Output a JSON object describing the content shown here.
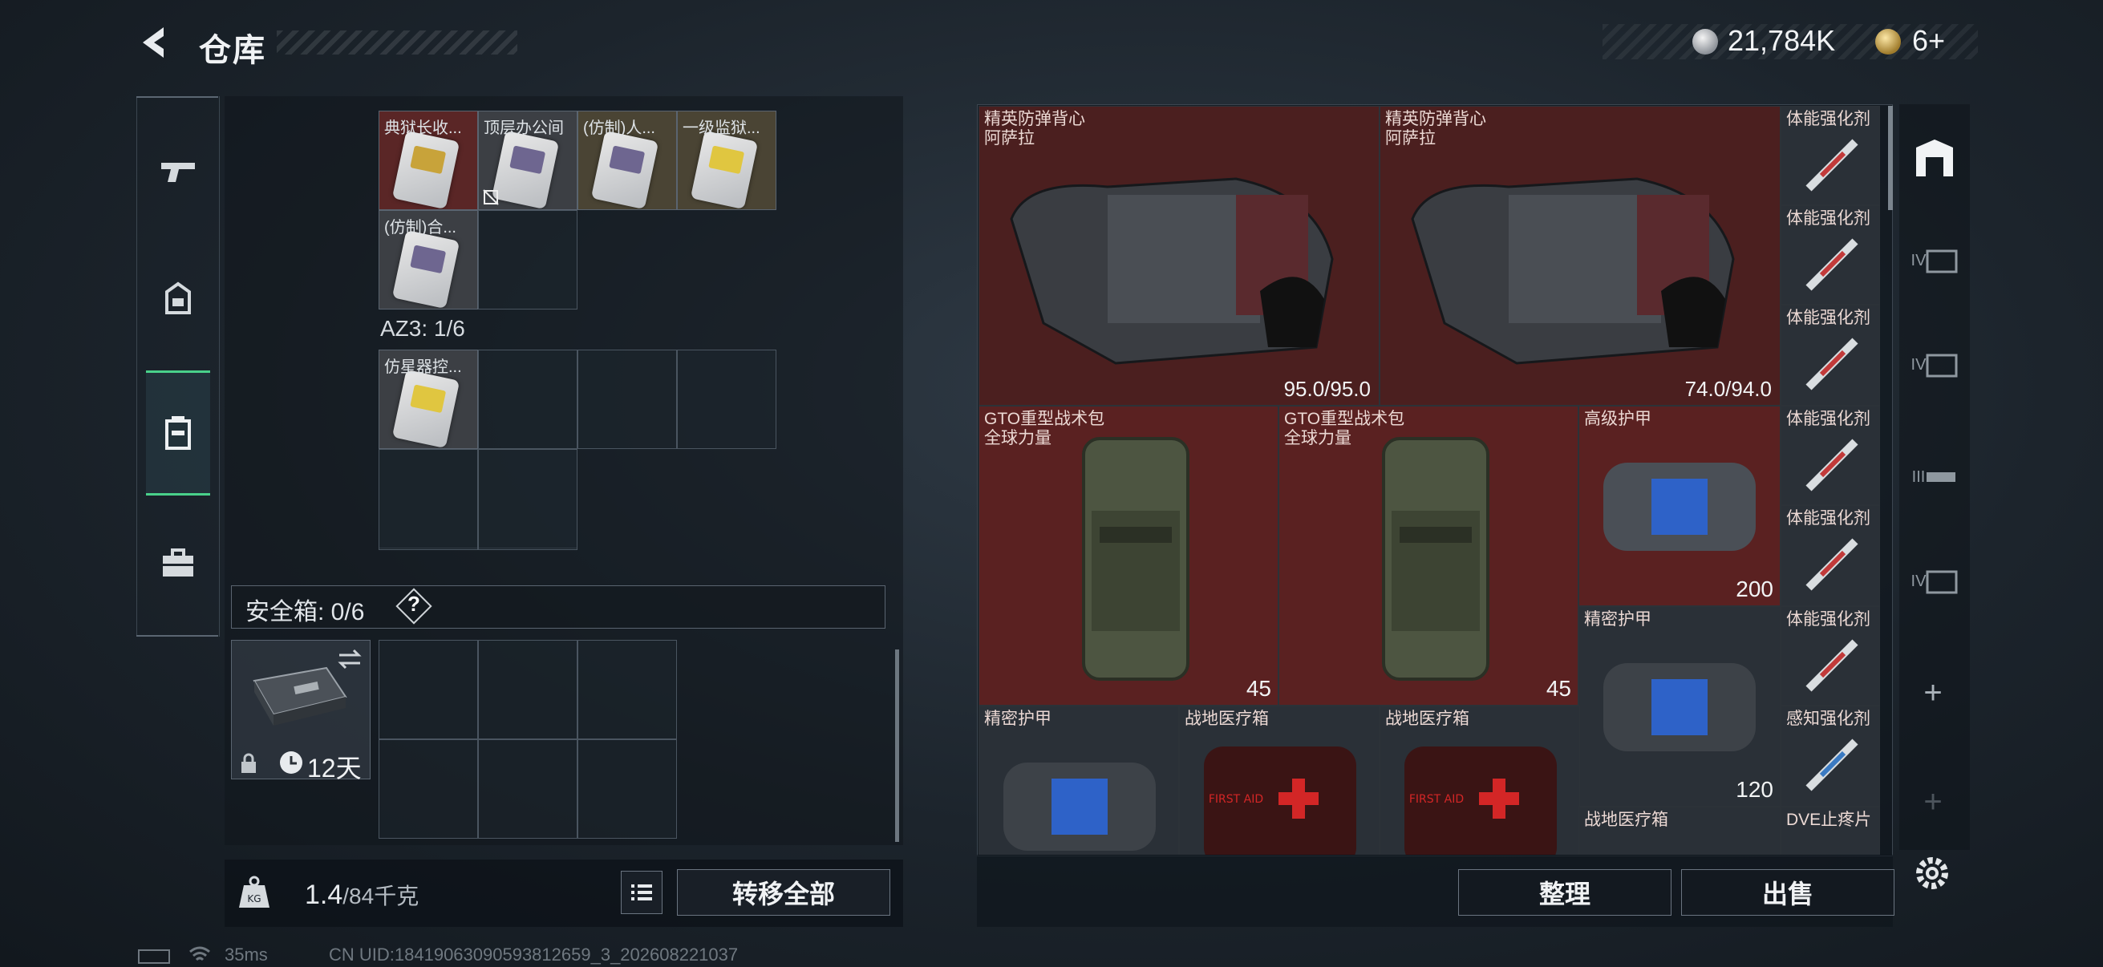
{
  "header": {
    "title": "仓库",
    "currency_silver": "21,784K",
    "currency_gold": "6+"
  },
  "left_nav": {
    "items": [
      {
        "name": "weapon",
        "icon": "gun-icon"
      },
      {
        "name": "gear",
        "icon": "helmet-icon"
      },
      {
        "name": "backpack",
        "icon": "backpack-icon",
        "active": true
      },
      {
        "name": "briefcase",
        "icon": "briefcase-icon"
      }
    ]
  },
  "container": {
    "row1_items": [
      "典狱长收...",
      "顶层办公间",
      "(仿制)人...",
      "一级监狱..."
    ],
    "row2_items": [
      "(仿制)合..."
    ],
    "az3_label": "AZ3: 1/6",
    "az3_items": [
      "仿星器控..."
    ],
    "safe_box_label": "安全箱: 0/6",
    "help_label": "?",
    "safe_box_time": "12天",
    "weight_current": "1.4",
    "weight_total": "/84千克",
    "transfer_all": "转移全部"
  },
  "stash": {
    "vests": [
      {
        "name": "精英防弹背心",
        "sub": "阿萨拉",
        "durability": "95.0/95.0"
      },
      {
        "name": "精英防弹背心",
        "sub": "阿萨拉",
        "durability": "74.0/94.0"
      }
    ],
    "bags": [
      {
        "name": "GTO重型战术包",
        "sub": "全球力量",
        "weight": "45"
      },
      {
        "name": "GTO重型战术包",
        "sub": "全球力量",
        "weight": "45"
      }
    ],
    "armors": [
      {
        "name": "高级护甲",
        "value": "200"
      },
      {
        "name": "精密护甲",
        "value": "120"
      }
    ],
    "bottom_row": {
      "armor": "精密护甲",
      "medkit1": "战地医疗箱",
      "medkit2": "战地医疗箱",
      "medkit3": "战地医疗箱"
    },
    "medkit_text": "FIRST AID",
    "side_items": [
      "体能强化剂",
      "体能强化剂",
      "体能强化剂",
      "体能强化剂",
      "体能强化剂",
      "体能强化剂",
      "感知强化剂",
      "DVE止疼片"
    ],
    "sort_button": "整理",
    "sell_button": "出售"
  },
  "right_tabs": {
    "tab_labels": [
      "IV",
      "IV",
      "III",
      "IV"
    ],
    "plus": "+"
  },
  "footer": {
    "ping": "35ms",
    "uid": "CN UID:18419063090593812659_3_202608221037"
  },
  "colors": {
    "accent_green": "#49d18a",
    "item_red_bg": "#5a2121"
  }
}
